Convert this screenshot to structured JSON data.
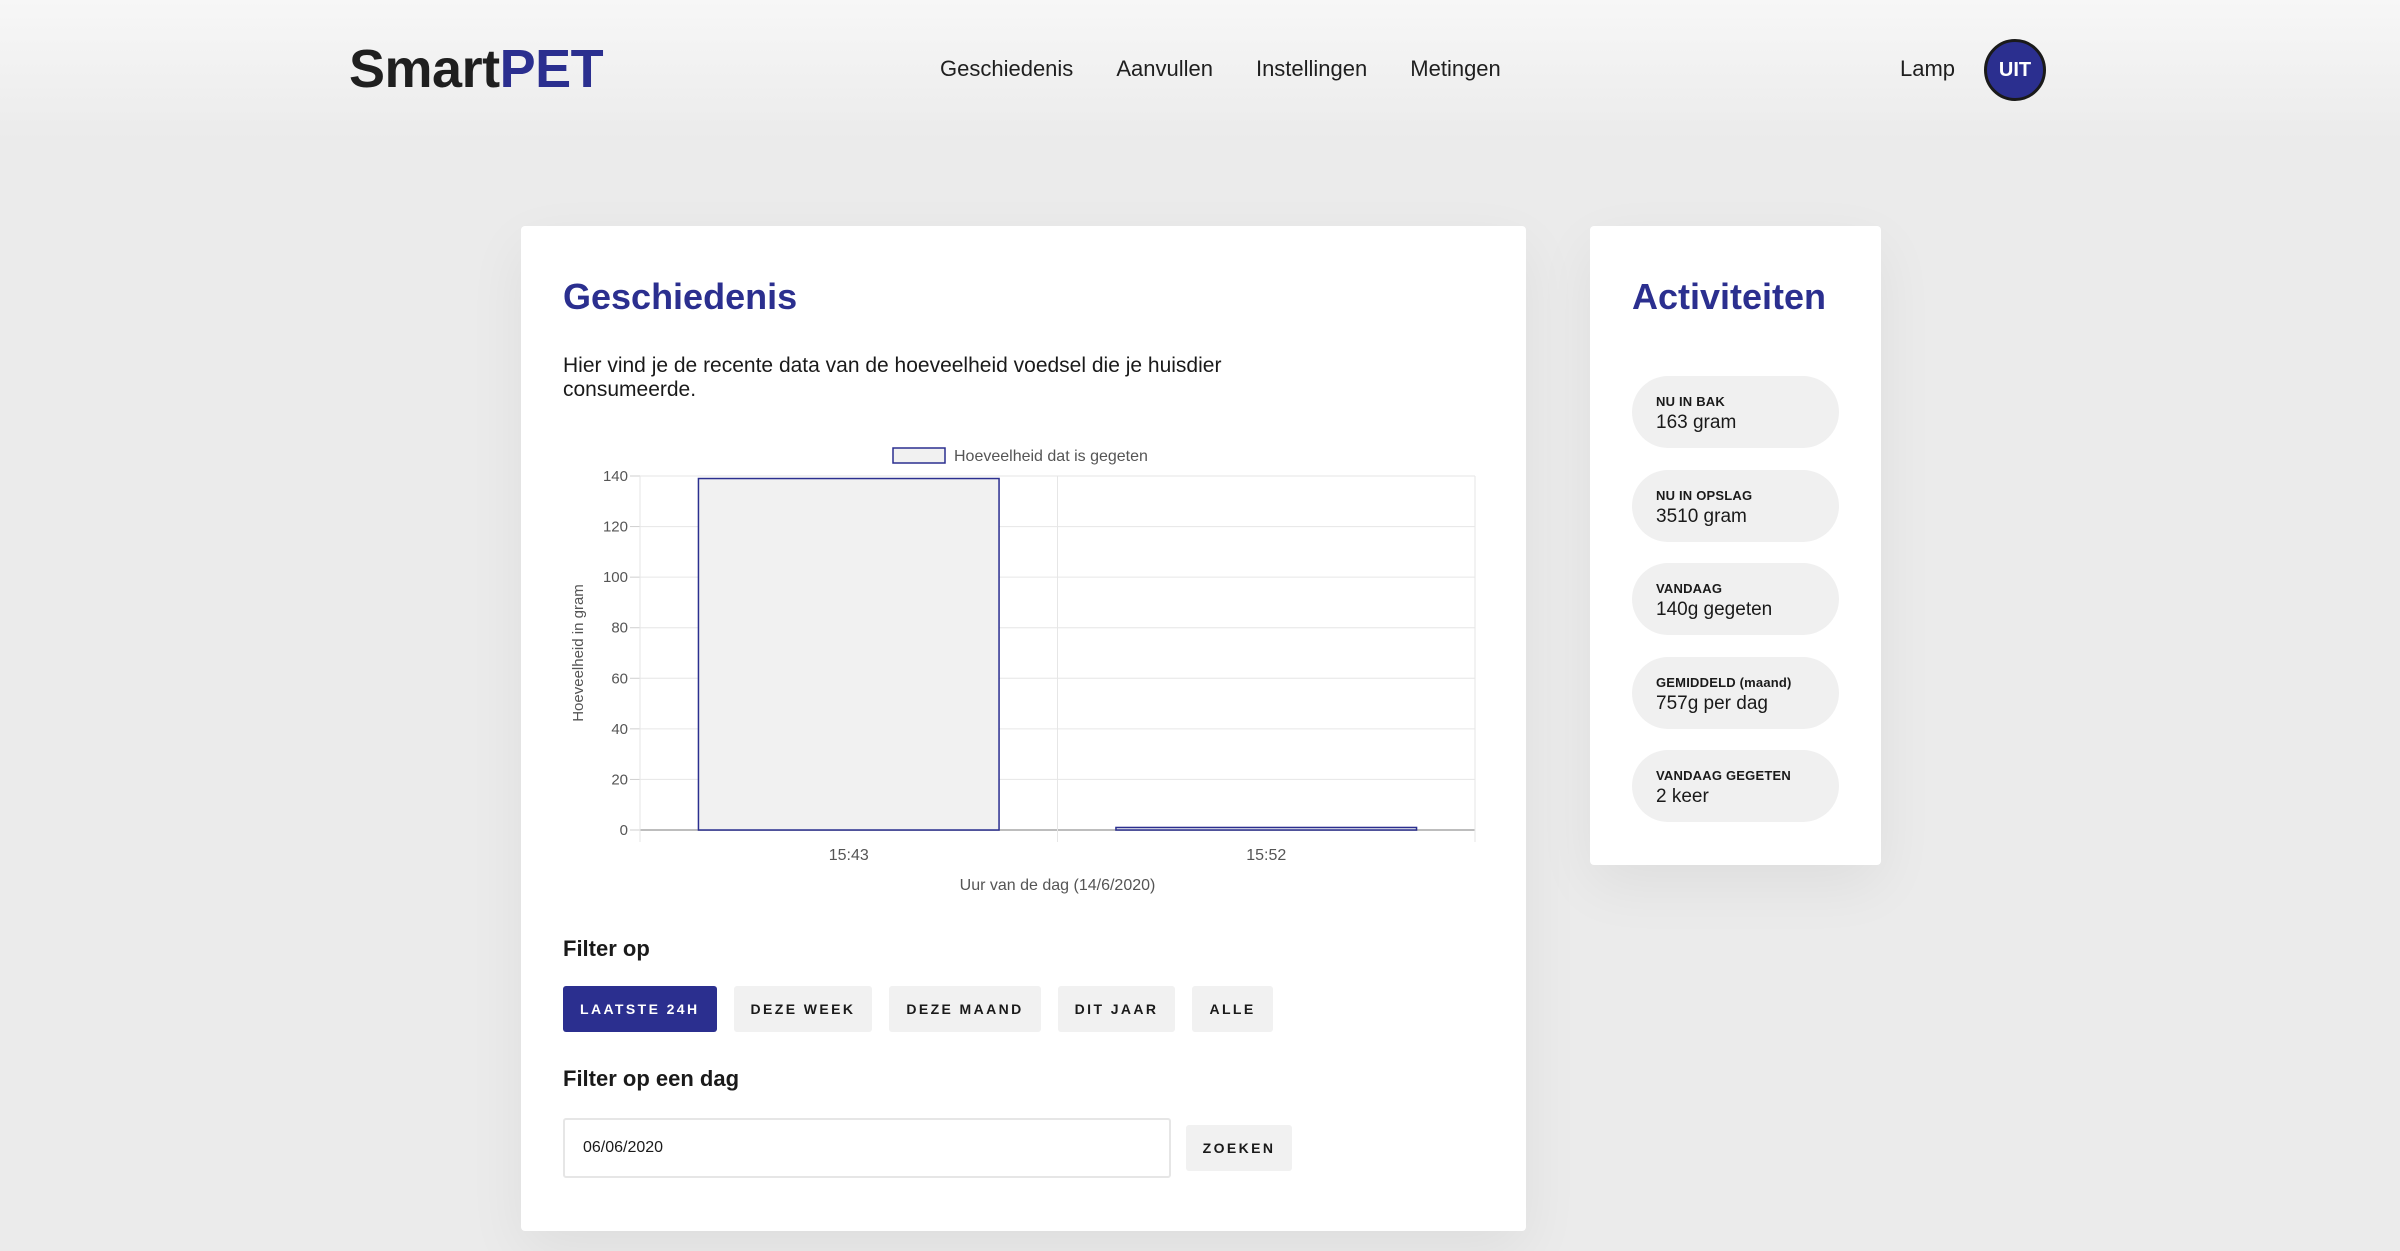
{
  "header": {
    "logo_part1": "Smart",
    "logo_part2": "PET",
    "nav": [
      "Geschiedenis",
      "Aanvullen",
      "Instellingen",
      "Metingen"
    ],
    "lamp_label": "Lamp",
    "lamp_button": "UIT"
  },
  "history": {
    "title": "Geschiedenis",
    "intro": "Hier vind je de recente data van de hoeveelheid voedsel die je huisdier consumeerde.",
    "filter_title": "Filter op",
    "filters": [
      "LAATSTE 24H",
      "DEZE WEEK",
      "DEZE MAAND",
      "DIT JAAR",
      "ALLE"
    ],
    "active_filter": "LAATSTE 24H",
    "day_filter_title": "Filter op een dag",
    "date_value": "06/06/2020",
    "search_label": "ZOEKEN"
  },
  "activities": {
    "title": "Activiteiten",
    "stats": [
      {
        "label": "NU IN BAK",
        "value": "163 gram"
      },
      {
        "label": "NU IN OPSLAG",
        "value": "3510 gram"
      },
      {
        "label": "VANDAAG",
        "value": "140g gegeten"
      },
      {
        "label": "GEMIDDELD (maand)",
        "value": "757g per dag"
      },
      {
        "label": "VANDAAG GEGETEN",
        "value": "2 keer"
      }
    ]
  },
  "colors": {
    "accent": "#2b2f8f",
    "bar_fill": "#f1f1f1"
  },
  "chart_data": {
    "type": "bar",
    "categories": [
      "15:43",
      "15:52"
    ],
    "series": [
      {
        "name": "Hoeveelheid dat is gegeten",
        "values": [
          139,
          1
        ]
      }
    ],
    "xlabel": "Uur van de dag (14/6/2020)",
    "ylabel": "Hoeveelheid in gram",
    "ylim": [
      0,
      140
    ],
    "yticks": [
      0,
      20,
      40,
      60,
      80,
      100,
      120,
      140
    ],
    "legend": "top",
    "grid": true
  }
}
